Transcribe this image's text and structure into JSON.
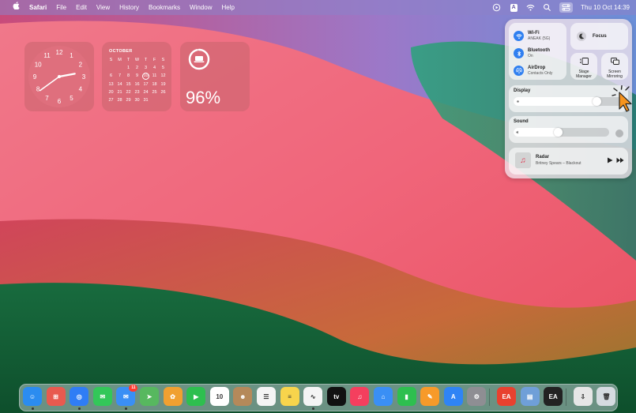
{
  "menubar": {
    "apple_icon": "apple-icon",
    "app_name": "Safari",
    "items": [
      "File",
      "Edit",
      "View",
      "History",
      "Bookmarks",
      "Window",
      "Help"
    ],
    "input_source": "A",
    "datetime": "Thu 10 Oct  14:39"
  },
  "widgets": {
    "clock": {
      "hour": 2,
      "minute": 39
    },
    "calendar": {
      "month": "OCTOBER",
      "weekdays": [
        "S",
        "M",
        "T",
        "W",
        "T",
        "F",
        "S"
      ],
      "days": [
        "",
        "",
        "1",
        "2",
        "3",
        "4",
        "5",
        "6",
        "7",
        "8",
        "9",
        "10",
        "11",
        "12",
        "13",
        "14",
        "15",
        "16",
        "17",
        "18",
        "19",
        "20",
        "21",
        "22",
        "23",
        "24",
        "25",
        "26",
        "27",
        "28",
        "29",
        "30",
        "31",
        "",
        ""
      ],
      "today": "10"
    },
    "battery": {
      "percent": "96%",
      "level": 0.96
    }
  },
  "control_center": {
    "wifi": {
      "title": "Wi-Fi",
      "subtitle": "ANEAK (5G)"
    },
    "bluetooth": {
      "title": "Bluetooth",
      "subtitle": "On"
    },
    "airdrop": {
      "title": "AirDrop",
      "subtitle": "Contacts Only"
    },
    "focus": "Focus",
    "stage_manager": [
      "Stage",
      "Manager"
    ],
    "screen_mirroring": [
      "Screen",
      "Mirroring"
    ],
    "display": {
      "label": "Display",
      "level": 0.78
    },
    "sound": {
      "label": "Sound",
      "level": 0.46
    },
    "now_playing": {
      "title": "Radar",
      "subtitle": "Britney Spears – Blackout"
    }
  },
  "dock": {
    "apps": [
      {
        "name": "finder",
        "color": "#2b8cf0",
        "glyph": "☺",
        "running": true
      },
      {
        "name": "launchpad",
        "color": "#e85a4f",
        "glyph": "⊞",
        "running": false
      },
      {
        "name": "safari",
        "color": "#2f7df5",
        "glyph": "◎",
        "running": true
      },
      {
        "name": "messages",
        "color": "#33c759",
        "glyph": "✉",
        "running": false
      },
      {
        "name": "mail",
        "color": "#3a8ff5",
        "glyph": "✉",
        "running": true,
        "badge": "11"
      },
      {
        "name": "maps",
        "color": "#57b85f",
        "glyph": "➤",
        "running": false
      },
      {
        "name": "photos",
        "color": "#f0a030",
        "glyph": "✿",
        "running": false
      },
      {
        "name": "facetime",
        "color": "#2ebf4f",
        "glyph": "▶",
        "running": false
      },
      {
        "name": "calendar",
        "color": "#ffffff",
        "glyph": "10",
        "running": false
      },
      {
        "name": "contacts",
        "color": "#b5895a",
        "glyph": "☻",
        "running": false
      },
      {
        "name": "reminders",
        "color": "#f4f4f4",
        "glyph": "☰",
        "running": false
      },
      {
        "name": "notes",
        "color": "#f7d44c",
        "glyph": "≡",
        "running": false
      },
      {
        "name": "freeform",
        "color": "#f4f4f4",
        "glyph": "∿",
        "running": true
      },
      {
        "name": "apple-tv",
        "color": "#111111",
        "glyph": "tv",
        "running": false
      },
      {
        "name": "music",
        "color": "#f43f5e",
        "glyph": "♫",
        "running": false
      },
      {
        "name": "keynote",
        "color": "#3a8ff5",
        "glyph": "⌂",
        "running": false
      },
      {
        "name": "numbers",
        "color": "#2ebf4f",
        "glyph": "▮",
        "running": false
      },
      {
        "name": "pages",
        "color": "#f79a2a",
        "glyph": "✎",
        "running": false
      },
      {
        "name": "app-store",
        "color": "#2f84f5",
        "glyph": "A",
        "running": false
      },
      {
        "name": "system-settings",
        "color": "#8e8e93",
        "glyph": "⚙",
        "running": false
      },
      {
        "name": "ea-app-1",
        "color": "#e8412f",
        "glyph": "EA",
        "running": false
      },
      {
        "name": "preview",
        "color": "#6f9fd8",
        "glyph": "▤",
        "running": false
      },
      {
        "name": "ea-app-2",
        "color": "#222222",
        "glyph": "EA",
        "running": false
      },
      {
        "name": "downloads",
        "color": "#e6e6e6",
        "glyph": "⇩",
        "running": false
      },
      {
        "name": "trash",
        "color": "#d5dbe0",
        "glyph": "🗑",
        "running": false
      }
    ]
  }
}
